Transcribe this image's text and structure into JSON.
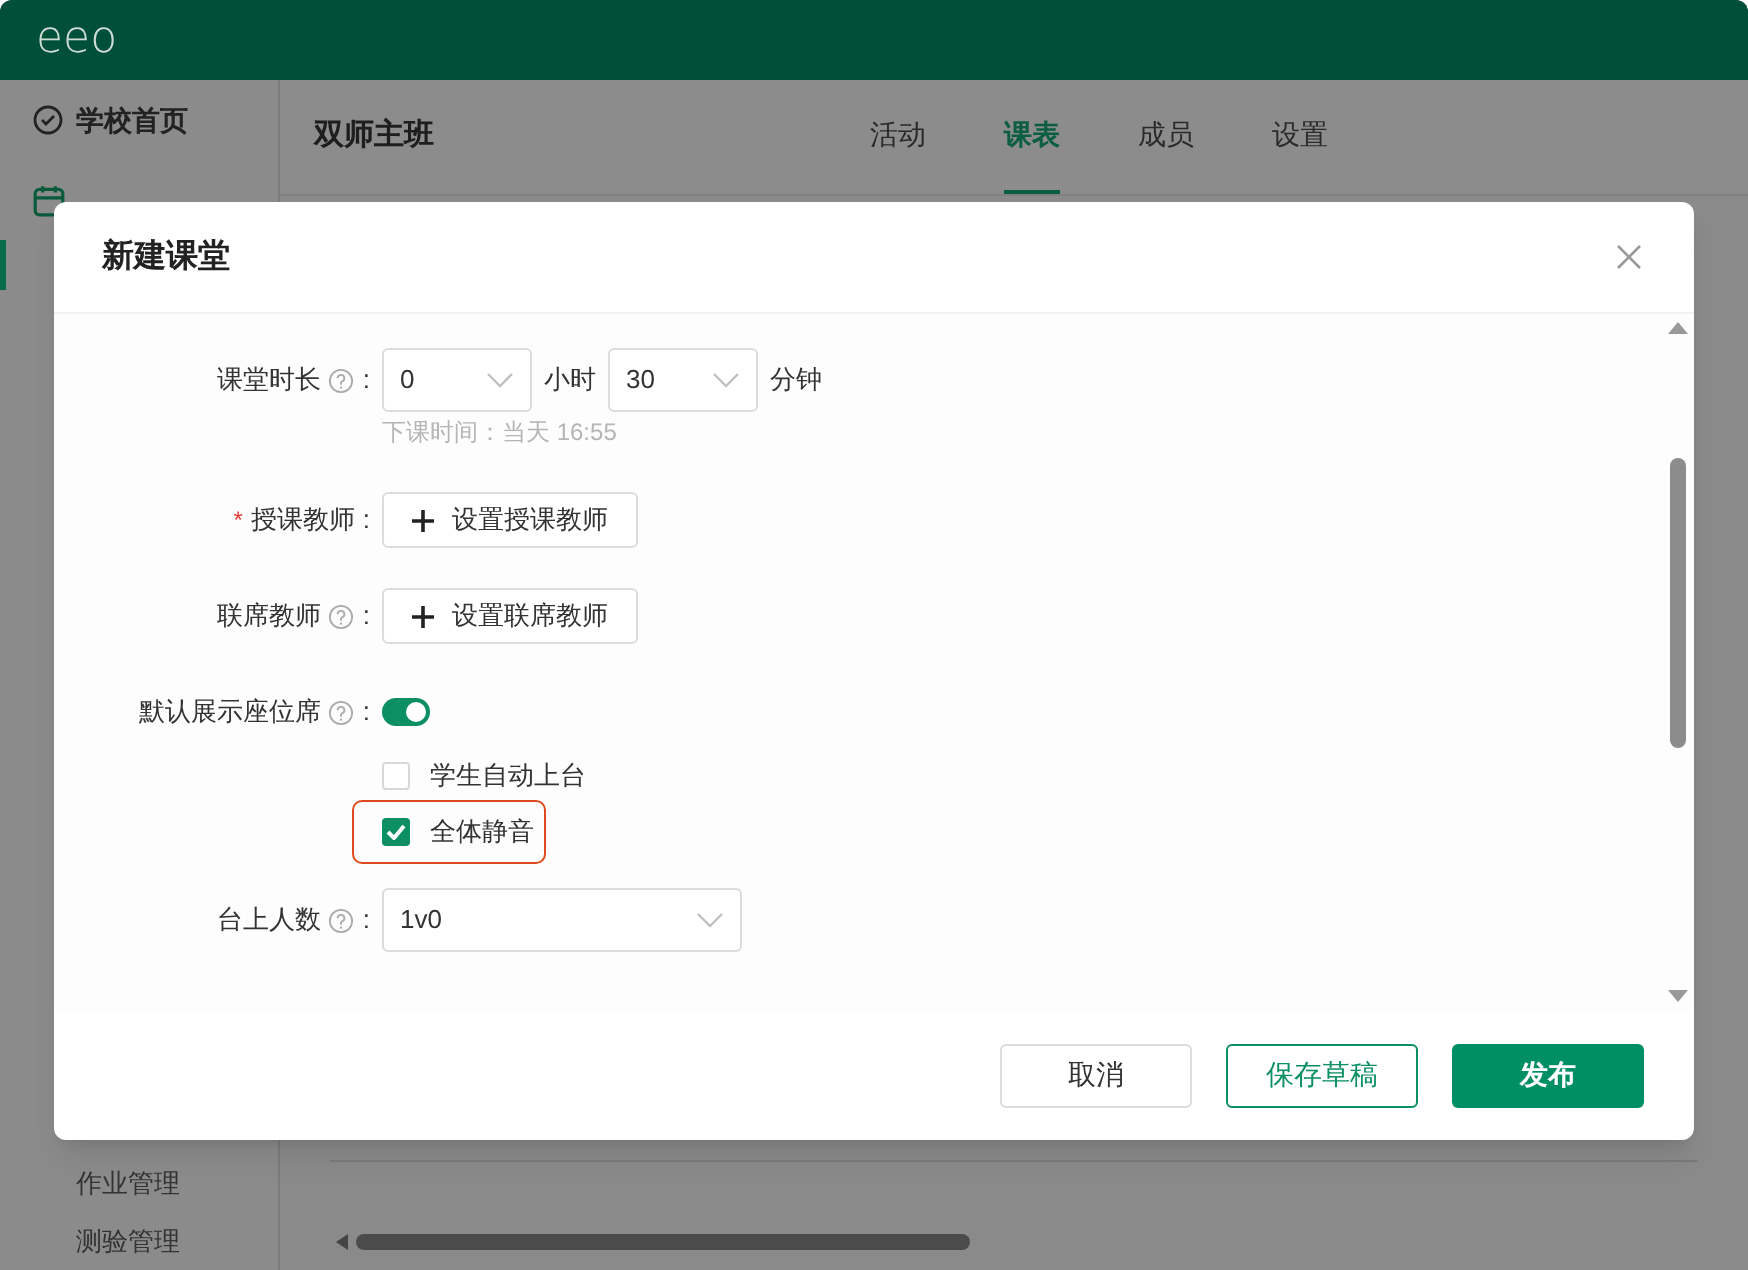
{
  "app": {
    "logo": "eeo"
  },
  "sidebar": {
    "items": [
      {
        "label": "学校首页",
        "selected": false
      },
      {
        "selected": true
      }
    ],
    "bottom_items": [
      {
        "label": "作业管理"
      },
      {
        "label": "测验管理"
      }
    ]
  },
  "page": {
    "title": "双师主班",
    "tabs": [
      {
        "label": "活动",
        "selected": false
      },
      {
        "label": "课表",
        "selected": true
      },
      {
        "label": "成员",
        "selected": false
      },
      {
        "label": "设置",
        "selected": false
      }
    ]
  },
  "dialog": {
    "title": "新建课堂",
    "fields": [
      {
        "kind": "duration",
        "label": "课堂时长",
        "colon": ":",
        "help": true,
        "hours": "0",
        "hours_unit": "小时",
        "minutes": "30",
        "minutes_unit": "分钟",
        "hint": "下课时间：当天 16:55"
      },
      {
        "kind": "button",
        "label": "授课教师",
        "colon": ":",
        "help": false,
        "required_mark": "*",
        "button": "设置授课教师"
      },
      {
        "kind": "button",
        "label": "联席教师",
        "colon": ":",
        "help": true,
        "button": "设置联席教师"
      },
      {
        "kind": "toggle",
        "label": "默认展示座位席",
        "colon": ":",
        "help": true,
        "on": true,
        "options": [
          {
            "label": "学生自动上台",
            "checked": false,
            "highlighted": false
          },
          {
            "label": "全体静音",
            "checked": true,
            "highlighted": true
          }
        ]
      },
      {
        "kind": "select",
        "label": "台上人数",
        "colon": ":",
        "help": true,
        "value": "1v0"
      }
    ],
    "buttons": [
      {
        "label": "取消",
        "kind": "default"
      },
      {
        "label": "保存草稿",
        "kind": "outline"
      },
      {
        "label": "发布",
        "kind": "primary"
      }
    ]
  }
}
